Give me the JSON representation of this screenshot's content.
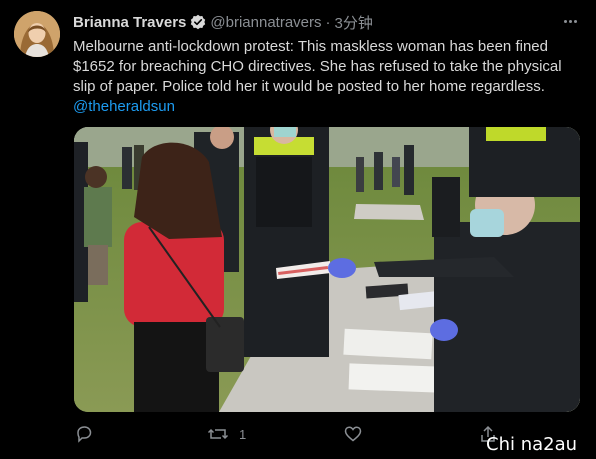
{
  "tweet": {
    "author": {
      "display_name": "Brianna Travers",
      "handle": "@briannatravers",
      "verified": true,
      "avatar_icon": "profile-photo"
    },
    "separator": "·",
    "timestamp": "3分钟",
    "more_icon": "ellipsis-icon",
    "text_lines": [
      "Melbourne anti-lockdown protest: This maskless woman has been fined",
      "$1652 for breaching CHO directives. She has refused to take the physical",
      "slip of paper. Police told her it would be posted to her home regardless."
    ],
    "mention": "@theheraldsun",
    "link_color": "#1d9bf0",
    "actions": {
      "reply_icon": "reply-icon",
      "retweet_icon": "retweet-icon",
      "retweet_count": "1",
      "like_icon": "heart-icon",
      "share_icon": "share-icon"
    }
  },
  "watermark": "Chi na2au",
  "colors": {
    "background": "#000000",
    "text": "#d9d9d9",
    "muted": "#8b8f94",
    "verified": "#d9d9d9"
  }
}
